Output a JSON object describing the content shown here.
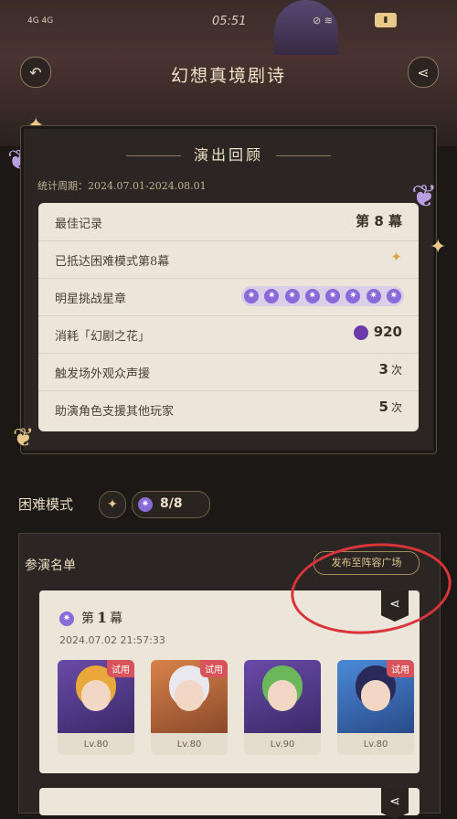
{
  "status_bar": {
    "signal": "4G 4G",
    "time": "05:51",
    "right_icons": "⊘ ≋"
  },
  "header": {
    "title": "幻想真境剧诗"
  },
  "review": {
    "title": "演出回顾",
    "period": "统计周期：2024.07.01-2024.08.01",
    "rows": [
      {
        "label": "最佳记录",
        "value": "第 8 幕"
      },
      {
        "label": "已抵达困难模式第8幕",
        "value": ""
      },
      {
        "label": "明星挑战星章",
        "value": ""
      },
      {
        "label": "消耗「幻剧之花」",
        "value": "920"
      },
      {
        "label": "触发场外观众声援",
        "value": "3",
        "unit": "次"
      },
      {
        "label": "助演角色支援其他玩家",
        "value": "5",
        "unit": "次"
      }
    ],
    "star_count": 8
  },
  "mode": {
    "label": "困难模式",
    "count": "8/8"
  },
  "roster": {
    "title": "参演名单",
    "publish_label": "发布至阵容广场",
    "act": {
      "prefix": "第",
      "number": "1",
      "suffix": "幕",
      "date": "2024.07.02 21:57:33"
    },
    "characters": [
      {
        "level": "Lv.80",
        "trial": "试用",
        "bg": "#6a4aa8",
        "hair": "#e8a83a"
      },
      {
        "level": "Lv.80",
        "trial": "试用",
        "bg": "#d9824a",
        "hair": "#e8e8ee"
      },
      {
        "level": "Lv.90",
        "trial": "",
        "bg": "#6a4aa8",
        "hair": "#6ab85a"
      },
      {
        "level": "Lv.80",
        "trial": "试用",
        "bg": "#4a8ad8",
        "hair": "#2a2a5a"
      }
    ]
  }
}
